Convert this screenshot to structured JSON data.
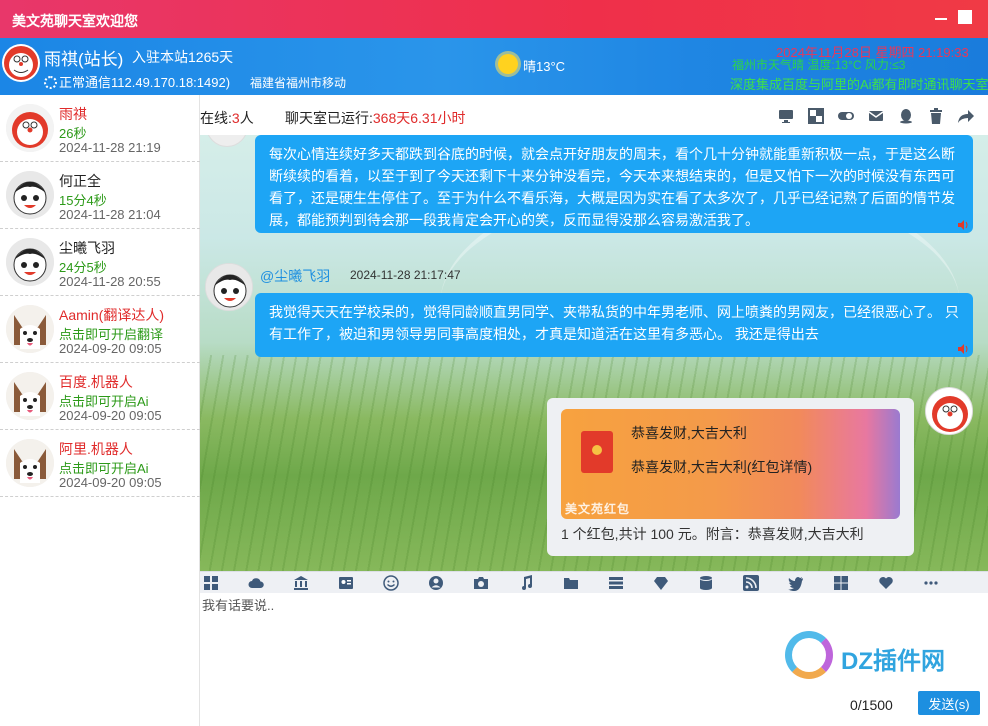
{
  "window": {
    "title": "美文苑聊天室欢迎您"
  },
  "header": {
    "username": "雨祺(站长)",
    "join_info": "入驻本站1265天",
    "connection": "正常通信112.49.170.18:1492)",
    "location": "福建省福州市移动",
    "weather_short": "晴13°C",
    "datetime": "2024年11月28日   星期四   21:19:33",
    "weather_long": "福州市天气晴 温度:13°C 风力:≤3",
    "ad": "深度集成百度与阿里的Ai都有即时通讯聊天室"
  },
  "sidebar": {
    "users": [
      {
        "name": "雨祺",
        "duration": "26秒",
        "date": "2024-11-28 21:19",
        "name_color": "red",
        "avatar": "doraemon-avatar"
      },
      {
        "name": "何正全",
        "duration": "15分4秒",
        "date": "2024-11-28 21:04",
        "name_color": "black",
        "avatar": "cartoon-boy-avatar"
      },
      {
        "name": "尘曦飞羽",
        "duration": "24分5秒",
        "date": "2024-11-28 20:55",
        "name_color": "black",
        "avatar": "cartoon-boy-avatar"
      },
      {
        "name": "Aamin(翻译达人)",
        "duration": "点击即可开启翻译",
        "date": "2024-09-20 09:05",
        "name_color": "red",
        "avatar": "husky-avatar"
      },
      {
        "name": "百度.机器人",
        "duration": "点击即可开启Ai",
        "date": "2024-09-20 09:05",
        "name_color": "red",
        "avatar": "husky-avatar"
      },
      {
        "name": "阿里.机器人",
        "duration": "点击即可开启Ai",
        "date": "2024-09-20 09:05",
        "name_color": "red",
        "avatar": "husky-avatar"
      }
    ]
  },
  "status": {
    "online_label": "在线:",
    "online_count": "3",
    "online_unit": "人",
    "runtime_label": "聊天室已运行:",
    "runtime_value": "368天6.31小时"
  },
  "messages": [
    {
      "text": "每次心情连续好多天都跌到谷底的时候，就会点开好朋友的周末，看个几十分钟就能重新积极一点，于是这么断断续续的看着，以至于到了今天还剩下十来分钟没看完，今天本来想结束的，但是又怕下一次的时候没有东西可看了，还是硬生生停住了。至于为什么不看乐海，大概是因为实在看了太多次了，几乎已经记熟了后面的情节发展，都能预判到待会那一段我肯定会开心的笑，反而显得没那么容易激活我了。"
    },
    {
      "sender": "@尘曦飞羽",
      "time": "2024-11-28 21:17:47",
      "text": "我觉得天天在学校呆的，觉得同龄顺直男同学、夹带私货的中年男老师、网上喷粪的男网友，已经很恶心了。 只有工作了，被迫和男领导男同事高度相处，才真是知道活在这里有多恶心。 我还是得出去"
    }
  ],
  "red_packet": {
    "line1": "恭喜发财,大吉大利",
    "line2": "恭喜发财,大吉大利(红包详情)",
    "brand": "美文苑红包",
    "note": "1 个红包,共计 100 元。附言：恭喜发财,大吉大利"
  },
  "input": {
    "placeholder": "我有话要说..",
    "counter": "0/1500",
    "send_label": "发送(s)"
  },
  "watermark": {
    "text": "DZ插件网"
  },
  "colors": {
    "accent_blue": "#1da5f5",
    "title_red": "#ef2f4a",
    "online_red": "#e02b2b",
    "duration_green": "#2c9a18"
  }
}
